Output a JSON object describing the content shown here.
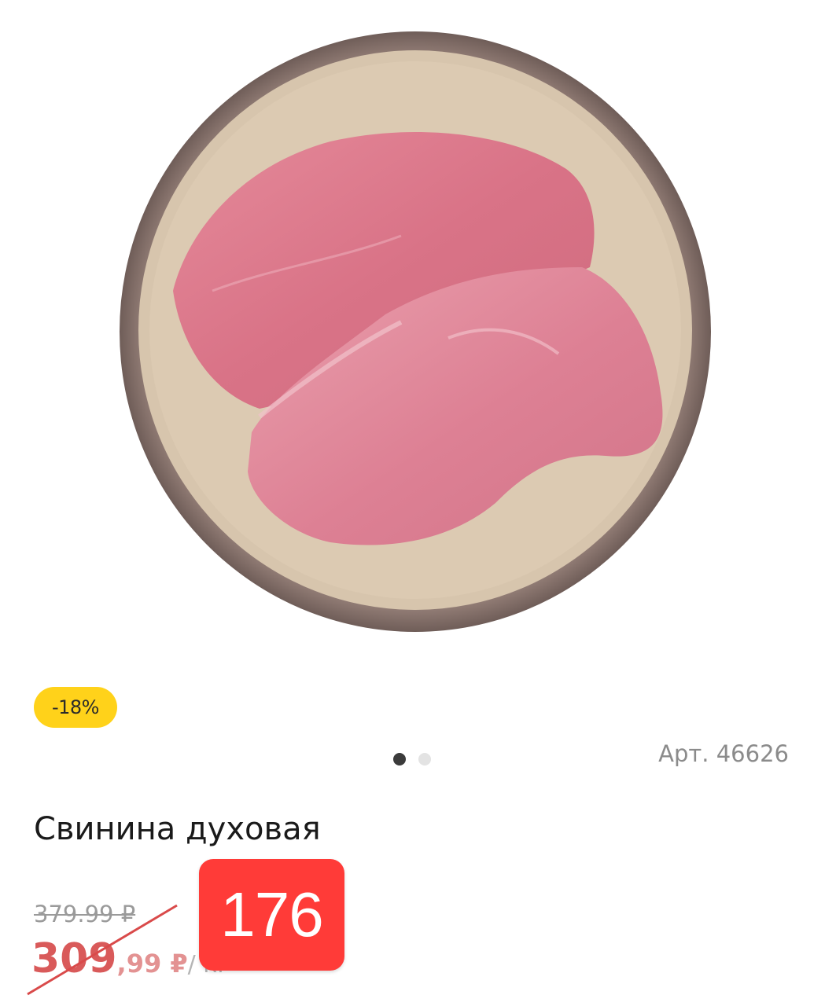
{
  "product": {
    "discount_badge": "-18%",
    "article": "Арт. 46626",
    "title": "Свинина духовая",
    "old_price": "379.99 ₽",
    "price_int": "309",
    "price_frac": ",99 ₽",
    "price_unit": "/ кг",
    "sticker_price": "176"
  },
  "gallery": {
    "dots": 2,
    "active": 0
  },
  "image": {
    "name": "pork-steaks-on-plate"
  },
  "colors": {
    "badge": "#ffd21a",
    "sticker": "#ff3b38",
    "price": "#d95a5a"
  }
}
